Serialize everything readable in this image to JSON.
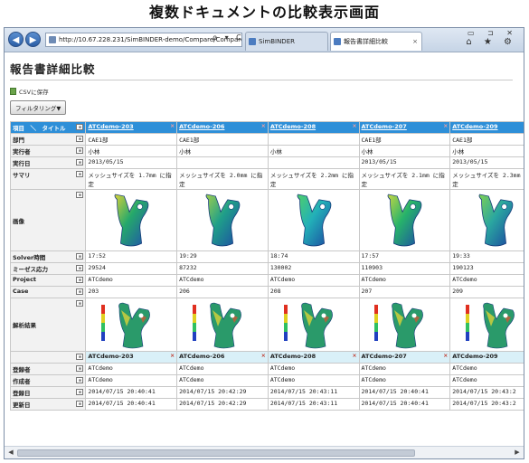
{
  "caption": "複数ドキュメントの比較表示画面",
  "browser": {
    "address": "http://10.67.228.231/SimBINDER-demo/Compare/Compare",
    "address_tools": "ρ ▾ C",
    "tabs": [
      {
        "label": "SimBINDER"
      },
      {
        "label": "報告書詳細比較",
        "close": "×"
      }
    ],
    "window_controls": "▭ ⊐ ✕",
    "tool_icons": "⌂ ★ ⚙"
  },
  "page": {
    "title": "報告書詳細比較",
    "csv_label": "CSVに保存",
    "filter_label": "フィルタリング▼"
  },
  "table": {
    "header_label": "項目　＼　タイトル",
    "columns": [
      "ATCdemo-203",
      "ATCdemo-206",
      "ATCdemo-208",
      "ATCdemo-207",
      "ATCdemo-209"
    ],
    "rows": [
      {
        "label": "部門",
        "values": [
          "CAE1部",
          "CAE1部",
          "",
          "CAE1部",
          "CAE1部"
        ]
      },
      {
        "label": "実行者",
        "values": [
          "小林",
          "小林",
          "小林",
          "小林",
          "小林"
        ]
      },
      {
        "label": "実行日",
        "values": [
          "2013/05/15",
          "",
          "",
          "2013/05/15",
          "2013/05/15"
        ]
      },
      {
        "label": "サマリ",
        "values": [
          "メッシュサイズを 1.7mm に指定",
          "メッシュサイズを 2.0mm に指定",
          "メッシュサイズを 2.2mm に指定",
          "メッシュサイズを 2.1mm に指定",
          "メッシュサイズを 2.3mm に指定"
        ]
      }
    ],
    "image_label": "画像",
    "rows2": [
      {
        "label": "Solver時間",
        "values": [
          "17:52",
          "19:29",
          "18:74",
          "17:57",
          "19:33"
        ]
      },
      {
        "label": "ミーゼス応力",
        "values": [
          "29524",
          "87232",
          "130002",
          "110903",
          "190123"
        ]
      },
      {
        "label": "Project",
        "values": [
          "ATCdemo",
          "ATCdemo",
          "ATCdemo",
          "ATCdemo",
          "ATCdemo"
        ]
      },
      {
        "label": "Case",
        "values": [
          "203",
          "206",
          "208",
          "207",
          "209"
        ]
      }
    ],
    "result_label": "解析結果",
    "rows3": [
      {
        "label": "登録者",
        "values": [
          "ATCdemo",
          "ATCdemo",
          "ATCdemo",
          "ATCdemo",
          "ATCdemo"
        ]
      },
      {
        "label": "作成者",
        "values": [
          "ATCdemo",
          "ATCdemo",
          "ATCdemo",
          "ATCdemo",
          "ATCdemo"
        ]
      },
      {
        "label": "登録日",
        "values": [
          "2014/07/15 20:40:41",
          "2014/07/15 20:42:29",
          "2014/07/15 20:43:11",
          "2014/07/15 20:40:41",
          "2014/07/15 20:43:2"
        ]
      },
      {
        "label": "更新日",
        "values": [
          "2014/07/15 20:40:41",
          "2014/07/15 20:42:29",
          "2014/07/15 20:43:11",
          "2014/07/15 20:40:41",
          "2014/07/15 20:43:2"
        ]
      }
    ],
    "remove_mark": "×",
    "cfg_mark": "≡"
  },
  "colors": {
    "header_blue": "#2e8fd8",
    "name_row_bg": "#d9f0f8"
  }
}
